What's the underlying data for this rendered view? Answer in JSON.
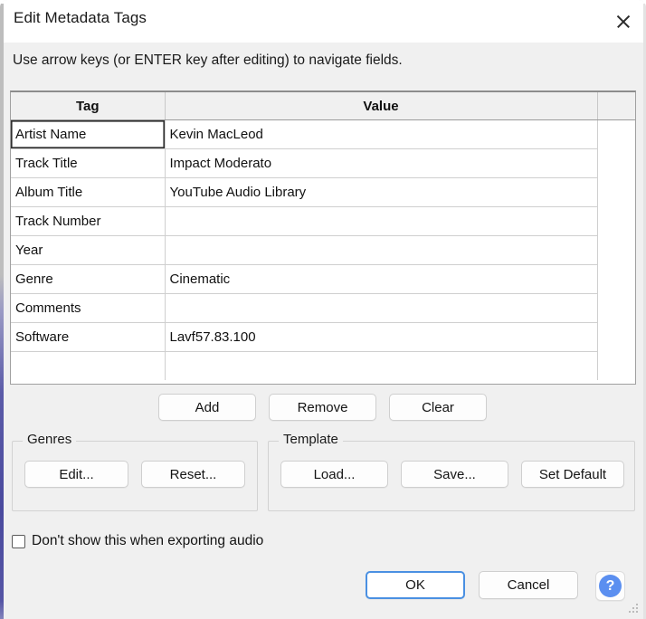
{
  "window": {
    "title": "Edit Metadata Tags",
    "close_icon": "close-icon"
  },
  "hint": "Use arrow keys (or ENTER key after editing) to navigate fields.",
  "table": {
    "columns": [
      "Tag",
      "Value"
    ],
    "rows": [
      {
        "tag": "Artist Name",
        "value": "Kevin MacLeod"
      },
      {
        "tag": "Track Title",
        "value": "Impact Moderato"
      },
      {
        "tag": "Album Title",
        "value": "YouTube Audio Library"
      },
      {
        "tag": "Track Number",
        "value": ""
      },
      {
        "tag": "Year",
        "value": ""
      },
      {
        "tag": "Genre",
        "value": "Cinematic"
      },
      {
        "tag": "Comments",
        "value": ""
      },
      {
        "tag": "Software",
        "value": "Lavf57.83.100"
      },
      {
        "tag": "",
        "value": ""
      }
    ]
  },
  "actions": {
    "add": "Add",
    "remove": "Remove",
    "clear": "Clear"
  },
  "genres": {
    "title": "Genres",
    "edit": "Edit...",
    "reset": "Reset..."
  },
  "template": {
    "title": "Template",
    "load": "Load...",
    "save": "Save...",
    "set_default": "Set Default"
  },
  "checkbox": {
    "label": "Don't show this when exporting audio",
    "checked": false
  },
  "footer": {
    "ok": "OK",
    "cancel": "Cancel",
    "help_icon": "help-icon",
    "help_glyph": "?"
  },
  "colors": {
    "accent": "#4a90e2",
    "help_blue": "#5b8ff0",
    "dialog_bg": "#f0f0f0",
    "window_edge": "#4a4a9e"
  }
}
